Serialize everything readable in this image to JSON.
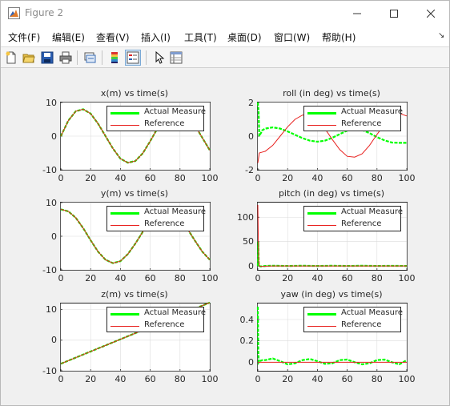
{
  "window": {
    "title": "Figure 2",
    "controls": [
      "minimize",
      "maximize",
      "close"
    ]
  },
  "menu": {
    "items": [
      "文件(F)",
      "编辑(E)",
      "查看(V)",
      "插入(I)",
      "工具(T)",
      "桌面(D)",
      "窗口(W)",
      "帮助(H)"
    ]
  },
  "toolbar": {
    "buttons": [
      {
        "icon": "new-figure-icon"
      },
      {
        "icon": "open-folder-icon"
      },
      {
        "icon": "save-icon"
      },
      {
        "icon": "print-icon"
      },
      {
        "icon": "link-plot-icon"
      },
      {
        "icon": "colorbar-icon"
      },
      {
        "icon": "legend-icon",
        "active": true
      },
      {
        "icon": "pointer-icon"
      },
      {
        "icon": "property-inspector-icon"
      }
    ]
  },
  "colors": {
    "actual": "#00ff00",
    "reference": "#e8201e",
    "axes": "#262626",
    "grid": "#dcdcdc"
  },
  "legend": {
    "actual": "Actual Measure",
    "reference": "Reference"
  },
  "chart_data": [
    {
      "type": "line",
      "title": "x(m) vs time(s)",
      "xlim": [
        0,
        100
      ],
      "ylim": [
        -10,
        10
      ],
      "xticks": [
        "0",
        "20",
        "40",
        "60",
        "80",
        "100"
      ],
      "yticks": [
        "10",
        "0",
        "-10"
      ],
      "legend_position": "top-right",
      "series": [
        {
          "name": "Actual Measure",
          "x": [
            0,
            5,
            10,
            15,
            20,
            25,
            30,
            35,
            40,
            45,
            50,
            55,
            60,
            65,
            70,
            75,
            80,
            85,
            90,
            95,
            100
          ],
          "y": [
            0,
            4.6,
            7.4,
            8.0,
            6.7,
            3.7,
            0.0,
            -3.7,
            -6.7,
            -7.9,
            -7.4,
            -5.1,
            -1.5,
            2.4,
            5.6,
            7.6,
            7.8,
            6.2,
            3.2,
            -0.5,
            -4.2
          ]
        },
        {
          "name": "Reference",
          "x": [
            0,
            5,
            10,
            15,
            20,
            25,
            30,
            35,
            40,
            45,
            50,
            55,
            60,
            65,
            70,
            75,
            80,
            85,
            90,
            95,
            100
          ],
          "y": [
            0,
            4.6,
            7.4,
            8.0,
            6.7,
            3.7,
            0.0,
            -3.7,
            -6.7,
            -7.9,
            -7.4,
            -5.1,
            -1.5,
            2.4,
            5.6,
            7.6,
            7.8,
            6.2,
            3.2,
            -0.5,
            -4.2
          ]
        }
      ]
    },
    {
      "type": "line",
      "title": "roll (in deg) vs time(s)",
      "xlim": [
        0,
        100
      ],
      "ylim": [
        -2,
        2
      ],
      "xticks": [
        "0",
        "20",
        "40",
        "60",
        "80",
        "100"
      ],
      "yticks": [
        "2",
        "0",
        "-2"
      ],
      "legend_position": "top-right",
      "series": [
        {
          "name": "Actual Measure",
          "x": [
            0,
            0.5,
            1,
            3,
            5,
            10,
            15,
            20,
            25,
            30,
            35,
            40,
            45,
            50,
            55,
            60,
            65,
            70,
            75,
            80,
            85,
            90,
            95,
            100
          ],
          "y": [
            2.0,
            1.5,
            0.0,
            0.35,
            0.45,
            0.52,
            0.45,
            0.28,
            0.08,
            -0.12,
            -0.27,
            -0.33,
            -0.27,
            -0.1,
            0.12,
            0.33,
            0.43,
            0.37,
            0.18,
            -0.06,
            -0.25,
            -0.38,
            -0.4,
            -0.4
          ]
        },
        {
          "name": "Reference",
          "x": [
            0,
            0.5,
            1,
            3,
            5,
            10,
            15,
            20,
            25,
            30,
            35,
            40,
            45,
            50,
            55,
            60,
            65,
            70,
            75,
            80,
            85,
            90,
            95,
            100
          ],
          "y": [
            -1.6,
            -1.3,
            -1.0,
            -0.95,
            -0.9,
            -0.55,
            0.0,
            0.55,
            1.0,
            1.25,
            1.25,
            0.95,
            0.45,
            -0.2,
            -0.8,
            -1.2,
            -1.25,
            -1.05,
            -0.55,
            0.1,
            0.7,
            1.15,
            1.35,
            1.2
          ]
        }
      ]
    },
    {
      "type": "line",
      "title": "y(m) vs time(s)",
      "xlim": [
        0,
        100
      ],
      "ylim": [
        -10,
        10
      ],
      "xticks": [
        "0",
        "20",
        "40",
        "60",
        "80",
        "100"
      ],
      "yticks": [
        "10",
        "0",
        "-10"
      ],
      "legend_position": "top-right",
      "series": [
        {
          "name": "Actual Measure",
          "x": [
            0,
            5,
            10,
            15,
            20,
            25,
            30,
            35,
            40,
            45,
            50,
            55,
            60,
            65,
            70,
            75,
            80,
            85,
            90,
            95,
            100
          ],
          "y": [
            8.0,
            7.4,
            5.5,
            2.4,
            -1.2,
            -4.6,
            -7.0,
            -8.0,
            -7.4,
            -5.3,
            -2.2,
            1.3,
            4.6,
            7.0,
            7.9,
            7.3,
            5.3,
            2.2,
            -1.3,
            -4.6,
            -7.0
          ]
        },
        {
          "name": "Reference",
          "x": [
            0,
            5,
            10,
            15,
            20,
            25,
            30,
            35,
            40,
            45,
            50,
            55,
            60,
            65,
            70,
            75,
            80,
            85,
            90,
            95,
            100
          ],
          "y": [
            8.0,
            7.4,
            5.5,
            2.4,
            -1.2,
            -4.6,
            -7.0,
            -8.0,
            -7.4,
            -5.3,
            -2.2,
            1.3,
            4.6,
            7.0,
            7.9,
            7.3,
            5.3,
            2.2,
            -1.3,
            -4.6,
            -7.0
          ]
        }
      ]
    },
    {
      "type": "line",
      "title": "pitch (in deg) vs time(s)",
      "xlim": [
        0,
        100
      ],
      "ylim": [
        -8,
        130
      ],
      "xticks": [
        "0",
        "20",
        "40",
        "60",
        "80",
        "100"
      ],
      "yticks": [
        "100",
        "50",
        "0"
      ],
      "legend_position": "top-right",
      "series": [
        {
          "name": "Actual Measure",
          "x": [
            0,
            0.3,
            0.6,
            1,
            2,
            5,
            10,
            20,
            30,
            40,
            50,
            60,
            70,
            80,
            90,
            100
          ],
          "y": [
            0,
            50,
            5,
            0,
            -1,
            0,
            0.5,
            0,
            0.5,
            0,
            0.5,
            0,
            0.5,
            0,
            0.3,
            0
          ]
        },
        {
          "name": "Reference",
          "x": [
            0,
            0.3,
            0.6,
            1,
            2,
            5,
            10,
            20,
            30,
            40,
            50,
            60,
            70,
            80,
            90,
            100
          ],
          "y": [
            125,
            60,
            10,
            0,
            -1,
            -0.5,
            0,
            0,
            0,
            0,
            0,
            0,
            0,
            0,
            0,
            0
          ]
        }
      ]
    },
    {
      "type": "line",
      "title": "z(m) vs time(s)",
      "xlim": [
        0,
        100
      ],
      "ylim": [
        -10,
        12
      ],
      "xticks": [
        "0",
        "20",
        "40",
        "60",
        "80",
        "100"
      ],
      "yticks": [
        "10",
        "0",
        "-10"
      ],
      "legend_position": "top-right",
      "series": [
        {
          "name": "Actual Measure",
          "x": [
            0,
            100
          ],
          "y": [
            -7.7,
            12.3
          ]
        },
        {
          "name": "Reference",
          "x": [
            0,
            100
          ],
          "y": [
            -7.7,
            12.3
          ]
        }
      ]
    },
    {
      "type": "line",
      "title": "yaw (in deg) vs time(s)",
      "xlim": [
        0,
        100
      ],
      "ylim": [
        -0.08,
        0.55
      ],
      "xticks": [
        "0",
        "20",
        "40",
        "60",
        "80",
        "100"
      ],
      "yticks": [
        "0.4",
        "0.2",
        "0"
      ],
      "legend_position": "top-right",
      "series": [
        {
          "name": "Actual Measure",
          "x": [
            0,
            0.3,
            0.6,
            1,
            3,
            5,
            10,
            15,
            20,
            25,
            30,
            35,
            40,
            45,
            50,
            55,
            60,
            65,
            70,
            75,
            80,
            85,
            90,
            95,
            100
          ],
          "y": [
            0.52,
            0.1,
            0.0,
            0.01,
            0.02,
            0.02,
            0.035,
            0.01,
            -0.02,
            -0.01,
            0.02,
            0.03,
            0.01,
            -0.015,
            -0.01,
            0.02,
            0.025,
            0.0,
            -0.02,
            -0.01,
            0.02,
            0.025,
            0.0,
            -0.02,
            0.02
          ]
        },
        {
          "name": "Reference",
          "x": [
            0,
            100
          ],
          "y": [
            0,
            0
          ]
        }
      ]
    }
  ]
}
